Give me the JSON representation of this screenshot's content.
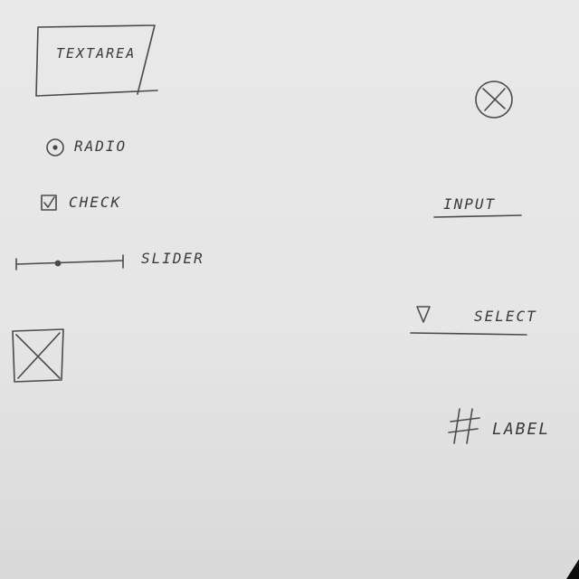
{
  "sketch": {
    "textarea": {
      "label": "TEXTAREA"
    },
    "radio": {
      "label": "RADIO"
    },
    "checkbox": {
      "label": "CHECK"
    },
    "slider": {
      "label": "SLIDER"
    },
    "input": {
      "label": "INPUT"
    },
    "select": {
      "label": "SELECT"
    },
    "label_widget": {
      "label": "LABEL"
    }
  }
}
